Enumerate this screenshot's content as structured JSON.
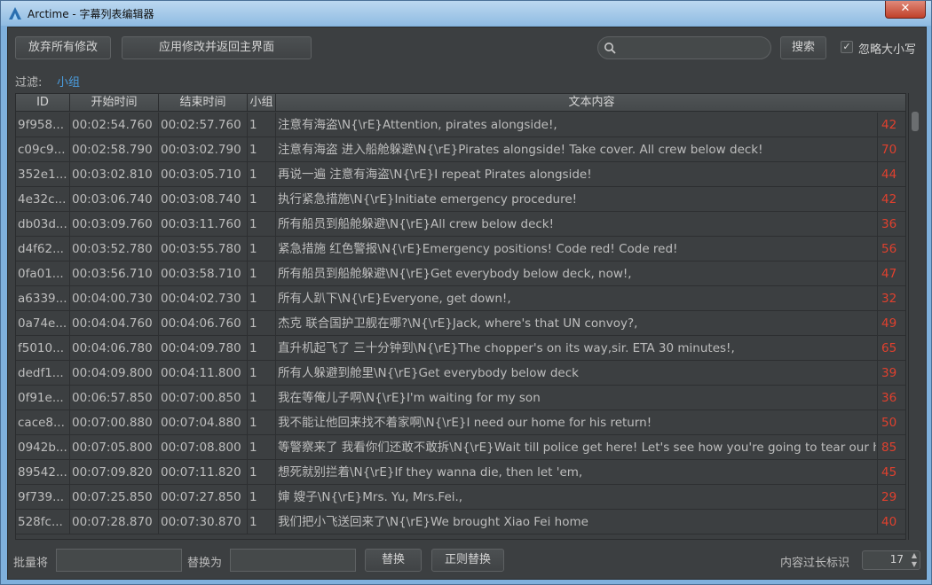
{
  "window": {
    "title": "Arctime - 字幕列表编辑器",
    "close_glyph": "✕"
  },
  "toolbar": {
    "discard_label": "放弃所有修改",
    "apply_label": "应用修改并返回主界面",
    "search_placeholder": "",
    "search_button_label": "搜索",
    "ignore_case_label": "忽略大小写",
    "ignore_case_checked": true
  },
  "filter": {
    "label": "过滤:",
    "value": "小组"
  },
  "table": {
    "columns": [
      "ID",
      "开始时间",
      "结束时间",
      "小组",
      "文本内容"
    ],
    "rows": [
      {
        "id": "9f958...",
        "start": "00:02:54.760",
        "end": "00:02:57.760",
        "group": "1",
        "text": "注意有海盗\\N{\\rE}Attention, pirates alongside!,",
        "len": "42"
      },
      {
        "id": "c09c9...",
        "start": "00:02:58.790",
        "end": "00:03:02.790",
        "group": "1",
        "text": "注意有海盗 进入船舱躲避\\N{\\rE}Pirates alongside! Take cover. All crew below deck!",
        "len": "70"
      },
      {
        "id": "352e1...",
        "start": "00:03:02.810",
        "end": "00:03:05.710",
        "group": "1",
        "text": "再说一遍 注意有海盗\\N{\\rE}I repeat Pirates alongside!",
        "len": "44"
      },
      {
        "id": "4e32c...",
        "start": "00:03:06.740",
        "end": "00:03:08.740",
        "group": "1",
        "text": "执行紧急措施\\N{\\rE}Initiate emergency procedure!",
        "len": "42"
      },
      {
        "id": "db03d...",
        "start": "00:03:09.760",
        "end": "00:03:11.760",
        "group": "1",
        "text": "所有船员到船舱躲避\\N{\\rE}All crew below deck!",
        "len": "36"
      },
      {
        "id": "d4f62...",
        "start": "00:03:52.780",
        "end": "00:03:55.780",
        "group": "1",
        "text": "紧急措施 红色警报\\N{\\rE}Emergency positions! Code red! Code red!",
        "len": "56"
      },
      {
        "id": "0fa01...",
        "start": "00:03:56.710",
        "end": "00:03:58.710",
        "group": "1",
        "text": "所有船员到船舱躲避\\N{\\rE}Get everybody below deck, now!,",
        "len": "47"
      },
      {
        "id": "a6339...",
        "start": "00:04:00.730",
        "end": "00:04:02.730",
        "group": "1",
        "text": "所有人趴下\\N{\\rE}Everyone, get down!,",
        "len": "32"
      },
      {
        "id": "0a74e...",
        "start": "00:04:04.760",
        "end": "00:04:06.760",
        "group": "1",
        "text": "杰克 联合国护卫舰在哪?\\N{\\rE}Jack, where's that UN convoy?,",
        "len": "49"
      },
      {
        "id": "f5010...",
        "start": "00:04:06.780",
        "end": "00:04:09.780",
        "group": "1",
        "text": "直升机起飞了 三十分钟到\\N{\\rE}The chopper's on its way,sir. ETA 30 minutes!,",
        "len": "65"
      },
      {
        "id": "dedf1...",
        "start": "00:04:09.800",
        "end": "00:04:11.800",
        "group": "1",
        "text": "所有人躲避到舱里\\N{\\rE}Get everybody below deck",
        "len": "39"
      },
      {
        "id": "0f91e...",
        "start": "00:06:57.850",
        "end": "00:07:00.850",
        "group": "1",
        "text": "我在等俺儿子啊\\N{\\rE}I'm waiting for my son",
        "len": "36"
      },
      {
        "id": "cace8...",
        "start": "00:07:00.880",
        "end": "00:07:04.880",
        "group": "1",
        "text": "我不能让他回来找不着家啊\\N{\\rE}I need our home for his return!",
        "len": "50"
      },
      {
        "id": "0942b...",
        "start": "00:07:05.800",
        "end": "00:07:08.800",
        "group": "1",
        "text": "等警察来了 我看你们还敢不敢拆\\N{\\rE}Wait till police get here! Let's see how you're going to tear our ho...",
        "len": "85"
      },
      {
        "id": "89542...",
        "start": "00:07:09.820",
        "end": "00:07:11.820",
        "group": "1",
        "text": "想死就别拦着\\N{\\rE}If they wanna die, then let 'em,",
        "len": "45"
      },
      {
        "id": "9f739...",
        "start": "00:07:25.850",
        "end": "00:07:27.850",
        "group": "1",
        "text": "婶 嫂子\\N{\\rE}Mrs. Yu, Mrs.Fei.,",
        "len": "29"
      },
      {
        "id": "528fc...",
        "start": "00:07:28.870",
        "end": "00:07:30.870",
        "group": "1",
        "text": "我们把小飞送回来了\\N{\\rE}We brought Xiao Fei home",
        "len": "40"
      }
    ]
  },
  "bottom": {
    "batch_label": "批量将",
    "batch_value": "",
    "replace_with_label": "替换为",
    "replace_with_value": "",
    "replace_button_label": "替换",
    "regex_replace_button_label": "正则替换",
    "overlength_label": "内容过长标识",
    "overlength_value": "17",
    "spin_up_glyph": "▲",
    "spin_down_glyph": "▼"
  },
  "colors": {
    "panel_bg": "#3c3f41",
    "accent": "#4b9ee0",
    "length_warning": "#e0402e"
  }
}
